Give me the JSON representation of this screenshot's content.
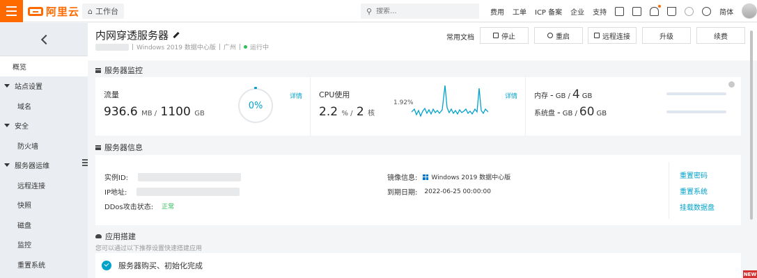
{
  "topbar": {
    "logo_text": "阿里云",
    "workbench_label": "工作台",
    "search_placeholder": "搜索...",
    "nav": [
      "费用",
      "工单",
      "ICP 备案",
      "企业",
      "支持"
    ],
    "lang": "简体",
    "accent": "#ff6a00"
  },
  "sidebar": {
    "items": [
      {
        "label": "概览",
        "kind": "active"
      },
      {
        "label": "站点设置",
        "kind": "group"
      },
      {
        "label": "域名",
        "kind": "sub"
      },
      {
        "label": "安全",
        "kind": "group"
      },
      {
        "label": "防火墙",
        "kind": "sub"
      },
      {
        "label": "服务器运维",
        "kind": "group"
      },
      {
        "label": "远程连接",
        "kind": "sub"
      },
      {
        "label": "快照",
        "kind": "sub"
      },
      {
        "label": "磁盘",
        "kind": "sub"
      },
      {
        "label": "监控",
        "kind": "sub"
      },
      {
        "label": "重置系统",
        "kind": "sub"
      }
    ]
  },
  "header": {
    "title": "内网穿透服务器",
    "os": "Windows 2019 数据中心版",
    "region": "广州",
    "status": "运行中",
    "sep": "|",
    "doc_link": "常用文档",
    "buttons": {
      "stop": "停止",
      "restart": "重启",
      "remote": "远程连接",
      "upgrade": "升级",
      "renew": "续费"
    }
  },
  "monitor": {
    "section_title": "服务器监控",
    "traffic": {
      "label": "流量",
      "used": "936.6",
      "used_unit": "MB /",
      "total": "1100",
      "total_unit": "GB",
      "percent_text": "0%",
      "percent": 0,
      "detail": "详情"
    },
    "cpu": {
      "label": "CPU使用",
      "value": "2.2",
      "unit": "% /",
      "cores": "2",
      "cores_unit": "核",
      "peak": "1.92%",
      "detail": "详情"
    },
    "memory": {
      "label": "内存",
      "used": "-",
      "unit_used": "GB /",
      "total": "4",
      "unit_total": "GB"
    },
    "disk": {
      "label": "系统盘",
      "used": "-",
      "unit_used": "GB /",
      "total": "60",
      "unit_total": "GB"
    }
  },
  "info": {
    "section_title": "服务器信息",
    "instance_label": "实例ID:",
    "ip_label": "IP地址:",
    "ddos_label": "DDos攻击状态:",
    "ddos_value": "正常",
    "image_label": "镜像信息:",
    "image_value": "Windows 2019 数据中心版",
    "expire_label": "到期日期:",
    "expire_value": "2022-06-25 00:00:00",
    "links": [
      "重置密码",
      "重置系统",
      "挂载数据盘"
    ]
  },
  "apps": {
    "section_title": "应用搭建",
    "hint": "您可以通过以下推荐设置快速搭建应用",
    "step1": "服务器购买、初始化完成"
  },
  "badge": "NEW"
}
